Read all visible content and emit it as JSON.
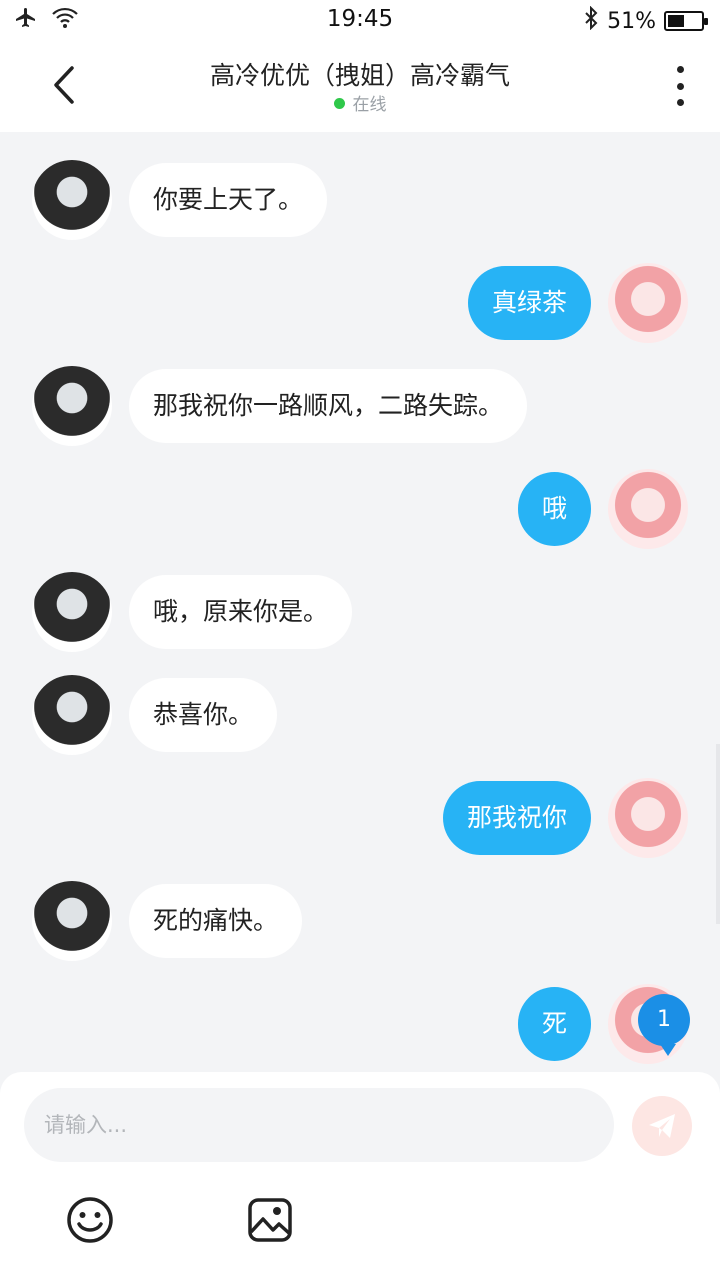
{
  "status_bar": {
    "time": "19:45",
    "battery_percent": "51%",
    "battery_level": 0.51,
    "icons": [
      "airplane-icon",
      "wifi-icon",
      "bluetooth-icon",
      "battery-icon"
    ]
  },
  "header": {
    "title": "高冷优优（拽姐）高冷霸气",
    "status": "在线",
    "status_color": "#2fc84a"
  },
  "messages": [
    {
      "side": "other",
      "text": "你要上天了。"
    },
    {
      "side": "me",
      "text": "真绿茶"
    },
    {
      "side": "other",
      "text": "那我祝你一路顺风，二路失踪。"
    },
    {
      "side": "me",
      "text": "哦"
    },
    {
      "side": "other",
      "text": "哦，原来你是。"
    },
    {
      "side": "other",
      "text": "恭喜你。"
    },
    {
      "side": "me",
      "text": "那我祝你"
    },
    {
      "side": "other",
      "text": "死的痛快。"
    },
    {
      "side": "me",
      "text": "死"
    }
  ],
  "unread_badge": "1",
  "input": {
    "placeholder": "请输入...",
    "value": ""
  },
  "colors": {
    "my_bubble": "#27b3f5",
    "other_bubble": "#ffffff",
    "background": "#f3f4f6",
    "badge": "#1b8fe6"
  }
}
